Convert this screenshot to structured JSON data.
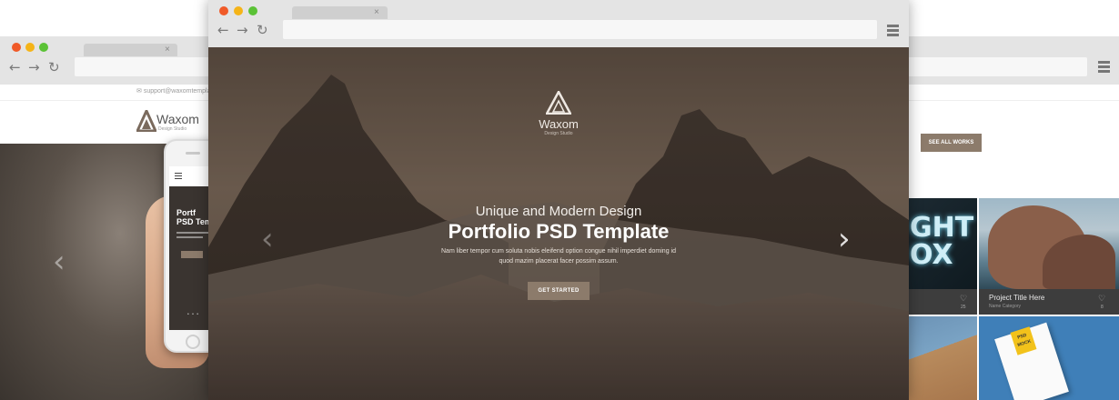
{
  "back_browser": {
    "support_email": "support@waxomtemplate.c",
    "logo_text": "Waxom",
    "logo_sub": "Design Studio",
    "see_all_label": "SEE ALL WORKS",
    "phone": {
      "title": "Portf\nPSD Tem",
      "dots": "• • •"
    },
    "lightbox_text": "GHT\nOX",
    "project": {
      "title": "Project Title Here",
      "category": "Name Category",
      "likes_left": "25",
      "likes_right": "8"
    },
    "mockup_badge": "PSD\nMOCK"
  },
  "front_browser": {
    "hero": {
      "logo_text": "Waxom",
      "logo_sub": "Design Studio",
      "subtitle": "Unique and Modern Design",
      "title": "Portfolio PSD Template",
      "body": "Nam liber tempor cum soluta nobis eleifend option congue nihil imperdiet doming id quod mazim placerat facer possim assum.",
      "cta_label": "GET STARTED"
    }
  },
  "chrome": {
    "close_glyph": "×",
    "back_glyph": "←",
    "forward_glyph": "→",
    "reload_glyph": "↻",
    "prev_glyph": "‹",
    "next_glyph": "›",
    "heart_glyph": "♡",
    "mail_glyph": "✉"
  },
  "colors": {
    "accent": "#8c7b6b",
    "dot_red": "#f05a28",
    "dot_yellow": "#f5b418",
    "dot_green": "#5bc236"
  }
}
